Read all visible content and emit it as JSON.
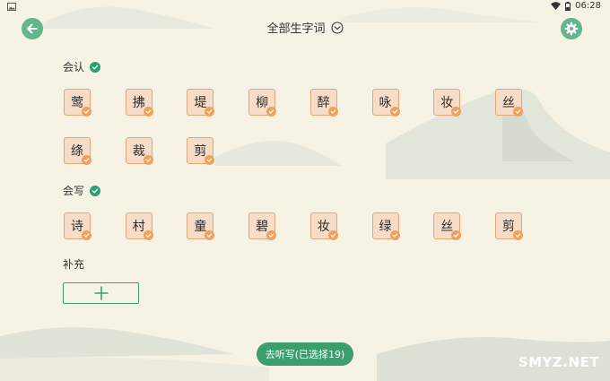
{
  "status_bar": {
    "time": "06:28"
  },
  "header": {
    "title": "全部生字词"
  },
  "sections": {
    "recognize": {
      "label": "会认",
      "chars": [
        "莺",
        "拂",
        "堤",
        "柳",
        "醉",
        "咏",
        "妆",
        "丝",
        "绦",
        "裁",
        "剪"
      ]
    },
    "write": {
      "label": "会写",
      "chars": [
        "诗",
        "村",
        "童",
        "碧",
        "妆",
        "绿",
        "丝",
        "剪"
      ]
    },
    "supplement": {
      "label": "补充"
    }
  },
  "footer": {
    "dictate_label": "去听写(已选择19)"
  },
  "watermark": {
    "text": "SMYZ.NET"
  },
  "colors": {
    "accent_green": "#3a9e6d",
    "tile_bg": "#f7ddc8",
    "tile_border": "#e2a57c",
    "tick_orange": "#f0a15e",
    "page_bg": "#f6f2e4"
  },
  "icons": [
    "back-arrow-icon",
    "gear-icon",
    "chevron-down-circle-icon",
    "check-circle-icon",
    "plus-icon",
    "wifi-icon",
    "battery-icon",
    "image-icon"
  ]
}
